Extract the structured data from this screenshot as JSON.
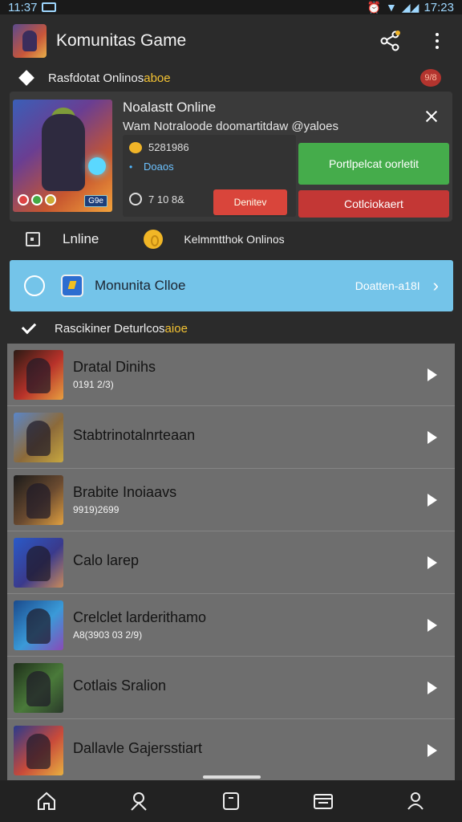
{
  "status_bar": {
    "time_left": "11:37",
    "time_right": "17:23"
  },
  "app_bar": {
    "title": "Komunitas Game"
  },
  "subheader": {
    "text": "Rasfdotat Onlinos",
    "highlight": "aboe",
    "badge": "9/8"
  },
  "featured": {
    "title": "Noalastt Online",
    "description": "Wam Notraloode doomartitdaw @yaloes",
    "meta_line1": "5281986",
    "meta_line2": "Doaos",
    "meta_line3": "7 10 8&",
    "art_tag": "G9e",
    "decline_label": "Denitev",
    "primary_green_label": "Portlpelcat oorletit",
    "primary_red_label": "Cotlciokaert"
  },
  "online_row": {
    "label": "Lnline",
    "right_text": "Kelmmtthok Onlinos"
  },
  "banner": {
    "title": "Monunita Clloe",
    "right_text": "Doatten-a18I"
  },
  "section2": {
    "text": "Rascikiner Deturlcos",
    "highlight": "aioe"
  },
  "games": [
    {
      "title": "Dratal Dinihs",
      "subtitle": "0191 2/3)"
    },
    {
      "title": "Stabtrinotalnrteaan",
      "subtitle": ""
    },
    {
      "title": "Brabite Inoiaavs",
      "subtitle": "9919)2699"
    },
    {
      "title": "Calo larep",
      "subtitle": ""
    },
    {
      "title": "Crelclet larderithamo",
      "subtitle": "A8(3903 03 2/9)"
    },
    {
      "title": "Cotlais Sralion",
      "subtitle": ""
    },
    {
      "title": "Dallavle Gajersstiart",
      "subtitle": ""
    }
  ],
  "colors": {
    "accent_green": "#45ac4b",
    "accent_red": "#c33735",
    "banner_blue": "#74c4e9",
    "highlight_yellow": "#f3c233"
  },
  "icons": {
    "nav": [
      "home-icon",
      "profile-icon",
      "square-icon",
      "folder-icon",
      "community-icon"
    ]
  }
}
